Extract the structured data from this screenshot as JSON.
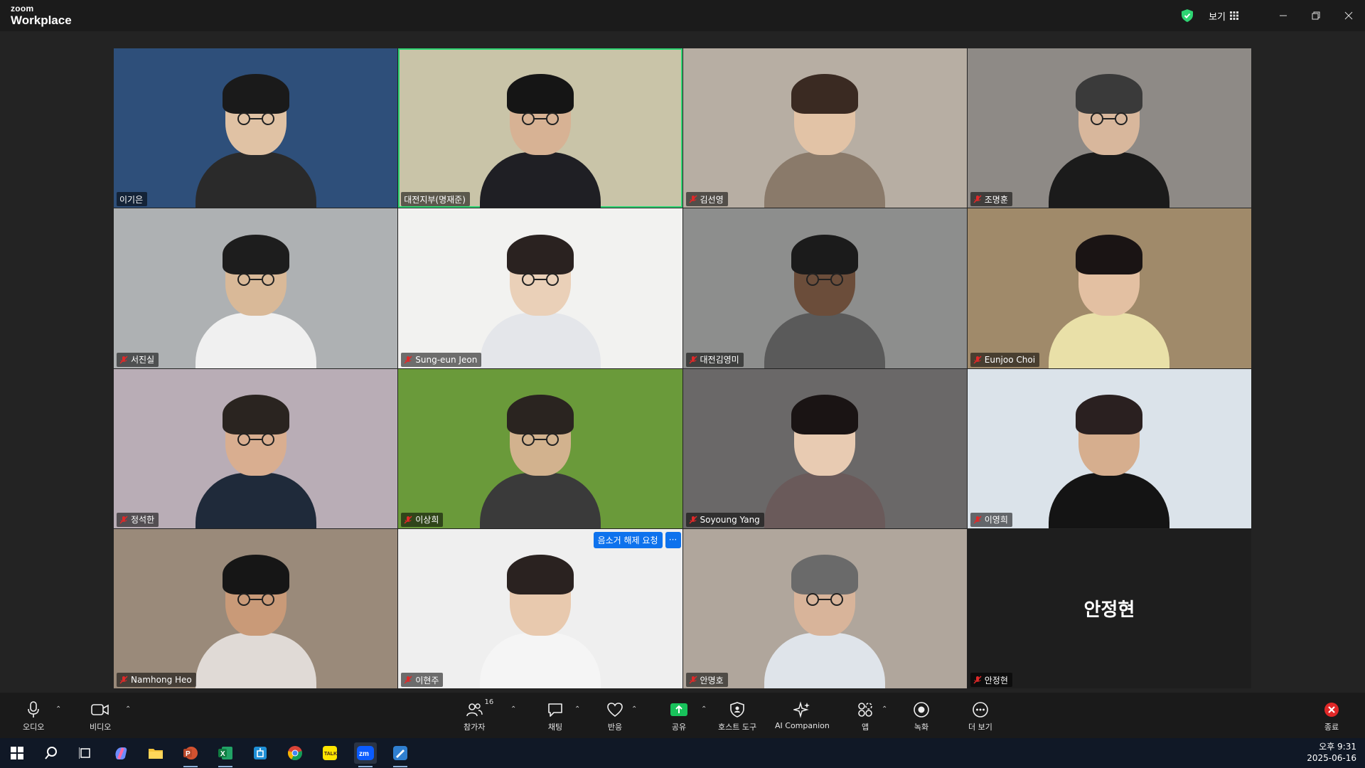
{
  "app": {
    "brand_top": "zoom",
    "brand_bottom": "Workplace"
  },
  "titlebar": {
    "view_label": "보기"
  },
  "participants": [
    {
      "name": "이기은",
      "muted": false,
      "bg": "#2e4f7a",
      "skin": "#e0c2a4",
      "hair": "#1a1a1a",
      "shirt": "#2a2a2a",
      "glasses": true,
      "active": false
    },
    {
      "name": "대전지부(명재준)",
      "muted": false,
      "bg": "#c9c4a8",
      "skin": "#d7b294",
      "hair": "#151515",
      "shirt": "#1f1f24",
      "glasses": true,
      "active": true
    },
    {
      "name": "김선영",
      "muted": true,
      "bg": "#b7aea3",
      "skin": "#e2c3a6",
      "hair": "#3a2a22",
      "shirt": "#8a7a6a",
      "glasses": false,
      "active": false
    },
    {
      "name": "조명훈",
      "muted": true,
      "bg": "#8e8a86",
      "skin": "#d8b79c",
      "hair": "#3a3a3a",
      "shirt": "#1b1b1b",
      "glasses": true,
      "active": false
    },
    {
      "name": "서진실",
      "muted": true,
      "bg": "#aeb1b3",
      "skin": "#d9b998",
      "hair": "#1d1d1d",
      "shirt": "#f0f0f0",
      "glasses": true,
      "active": false
    },
    {
      "name": "Sung-eun Jeon",
      "muted": true,
      "bg": "#f2f2f0",
      "skin": "#ead0b8",
      "hair": "#2a2220",
      "shirt": "#e4e6ea",
      "glasses": true,
      "active": false
    },
    {
      "name": "대전김영미",
      "muted": true,
      "bg": "#8d8e8d",
      "skin": "#6b4d3a",
      "hair": "#1b1b1b",
      "shirt": "#5a5a5a",
      "glasses": true,
      "active": false
    },
    {
      "name": "Eunjoo Choi",
      "muted": true,
      "bg": "#a08a6a",
      "skin": "#e3c0a2",
      "hair": "#1a1414",
      "shirt": "#e9e0a8",
      "glasses": false,
      "active": false
    },
    {
      "name": "정석한",
      "muted": true,
      "bg": "#b9adb6",
      "skin": "#d9ae90",
      "hair": "#2a2420",
      "shirt": "#1f2a3a",
      "glasses": true,
      "active": false
    },
    {
      "name": "이상희",
      "muted": true,
      "bg": "#6a9a3a",
      "skin": "#d2b28e",
      "hair": "#2a2420",
      "shirt": "#3a3a3a",
      "glasses": true,
      "active": false
    },
    {
      "name": "Soyoung Yang",
      "muted": true,
      "bg": "#6a6868",
      "skin": "#e8cbb2",
      "hair": "#1a1414",
      "shirt": "#6a5a5a",
      "glasses": false,
      "active": false
    },
    {
      "name": "이영희",
      "muted": true,
      "bg": "#dbe3ea",
      "skin": "#d6ae8e",
      "hair": "#2a2020",
      "shirt": "#141414",
      "glasses": false,
      "active": false
    },
    {
      "name": "Namhong Heo",
      "muted": true,
      "bg": "#9a8a7a",
      "skin": "#c99a78",
      "hair": "#161616",
      "shirt": "#e0dad6",
      "glasses": true,
      "active": false
    },
    {
      "name": "이현주",
      "muted": true,
      "bg": "#efefef",
      "skin": "#e8c9ae",
      "hair": "#2a2220",
      "shirt": "#f5f5f5",
      "glasses": false,
      "active": false,
      "unmute_request": "음소거 해제 요청",
      "more": "···"
    },
    {
      "name": "안명호",
      "muted": true,
      "bg": "#b0a69c",
      "skin": "#d8b49a",
      "hair": "#6a6a6a",
      "shirt": "#dfe4ea",
      "glasses": true,
      "active": false
    },
    {
      "name": "안정현",
      "muted": true,
      "video_off": true,
      "bg": "#1e1e1e"
    }
  ],
  "toolbar": {
    "audio": "오디오",
    "video": "비디오",
    "participants": "참가자",
    "participants_count": "16",
    "chat": "채팅",
    "reactions": "반응",
    "share": "공유",
    "host_tools": "호스트 도구",
    "ai_companion": "AI Companion",
    "apps": "앱",
    "record": "녹화",
    "more": "더 보기",
    "end": "종료"
  },
  "taskbar": {
    "time": "오후 9:31",
    "date": "2025-06-16"
  },
  "colors": {
    "accent_green": "#2ed573",
    "share_green": "#18c25b",
    "zoom_blue": "#0e72ed",
    "end_red": "#e02828"
  }
}
